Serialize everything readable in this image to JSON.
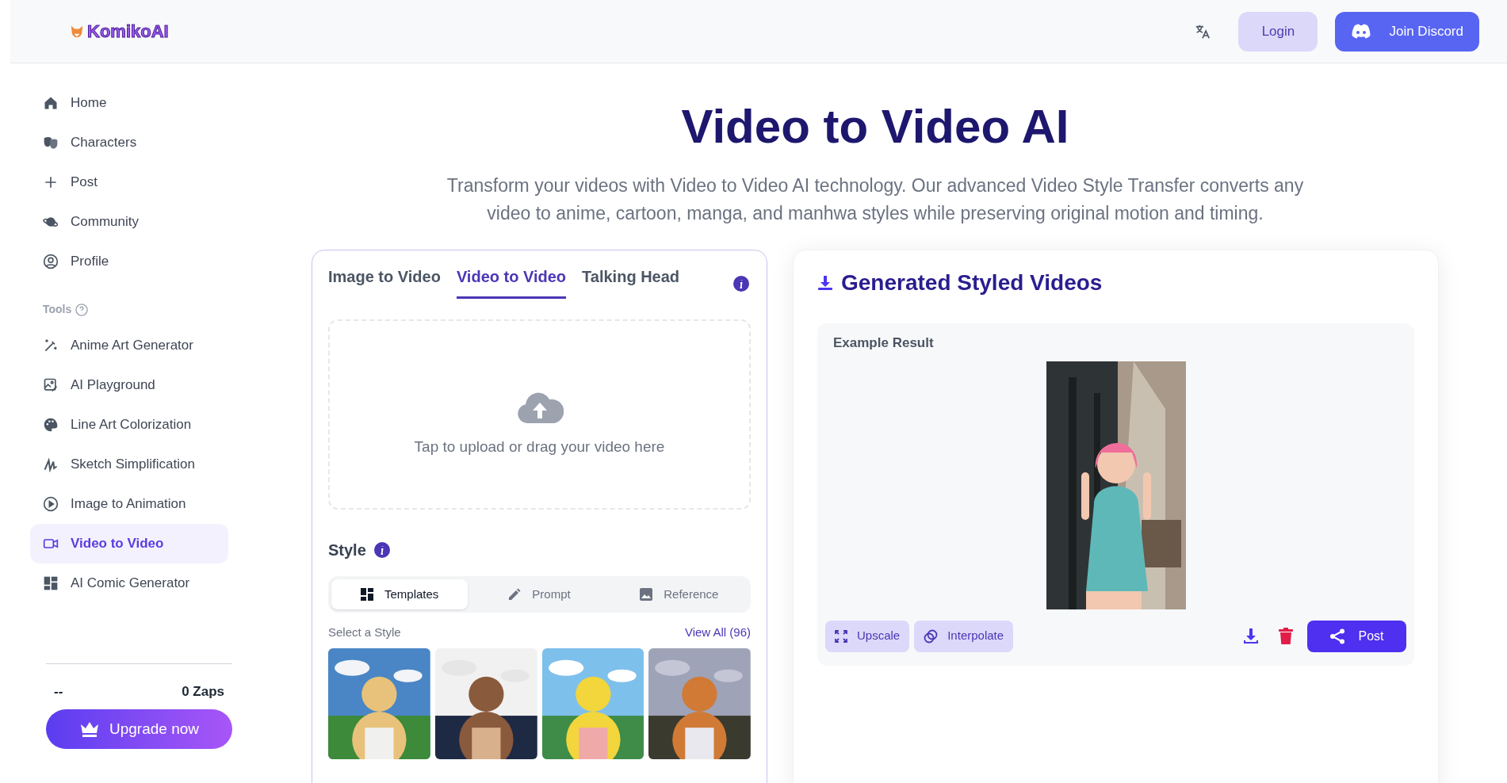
{
  "header": {
    "logo": "KomikoAI",
    "buttons": [
      {
        "label": "Login",
        "kind": "secondary"
      },
      {
        "label": "Join Discord",
        "kind": "discord"
      }
    ]
  },
  "sidebar": {
    "items": [
      {
        "label": "Home",
        "selected": false
      },
      {
        "label": "Characters",
        "selected": false
      },
      {
        "label": "Post",
        "selected": false
      },
      {
        "label": "Community",
        "selected": false
      },
      {
        "label": "Profile",
        "selected": false
      }
    ],
    "tools_label": "Tools",
    "tools": [
      {
        "label": "Anime Art Generator",
        "selected": false
      },
      {
        "label": "AI Playground",
        "selected": false
      },
      {
        "label": "Line Art Colorization",
        "selected": false
      },
      {
        "label": "Sketch Simplification",
        "selected": false
      },
      {
        "label": "Image to Animation",
        "selected": false
      },
      {
        "label": "Video to Video",
        "selected": true
      },
      {
        "label": "AI Comic Generator",
        "selected": false
      }
    ],
    "account": "--",
    "zaps": "0 Zaps",
    "upgrade": "Upgrade now"
  },
  "hero": {
    "title": "Video to Video AI",
    "description": "Transform your videos with Video to Video AI technology. Our advanced Video Style Transfer converts any video to anime, cartoon, manga, and manhwa styles while preserving original motion and timing."
  },
  "generator": {
    "tabs": [
      {
        "label": "Image to Video",
        "selected": false
      },
      {
        "label": "Video to Video",
        "selected": true
      },
      {
        "label": "Talking Head",
        "selected": false
      }
    ],
    "upload_hint": "Tap to upload or drag your video here",
    "style_title": "Style",
    "style_modes": [
      {
        "label": "Templates",
        "selected": true
      },
      {
        "label": "Prompt",
        "selected": false
      },
      {
        "label": "Reference",
        "selected": false
      }
    ],
    "select_label": "Select a Style",
    "view_all": "View All (96)"
  },
  "results": {
    "title": "Generated Styled Videos",
    "example_label": "Example Result",
    "actions": [
      {
        "label": "Upscale"
      },
      {
        "label": "Interpolate"
      }
    ],
    "post": "Post"
  }
}
